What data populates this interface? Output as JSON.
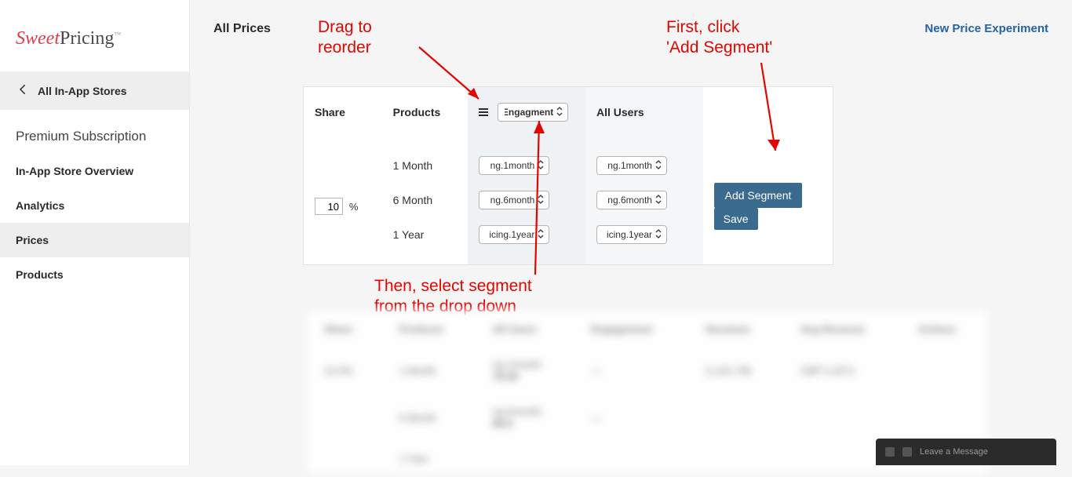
{
  "logo": {
    "part1": "Sweet",
    "part2": "Pricing",
    "tm": "™"
  },
  "sidebar": {
    "back_label": "All In-App Stores",
    "section_title": "Premium Subscription",
    "items": [
      {
        "label": "In-App Store Overview"
      },
      {
        "label": "Analytics"
      },
      {
        "label": "Prices"
      },
      {
        "label": "Products"
      }
    ]
  },
  "page": {
    "title": "All Prices",
    "new_experiment": "New Price Experiment"
  },
  "table": {
    "headers": {
      "share": "Share",
      "products": "Products",
      "segment_select": "Engagment",
      "all_users": "All Users"
    },
    "share_value": "10",
    "share_suffix": "%",
    "rows": [
      {
        "product": "1 Month",
        "seg_value": "ng.1month",
        "users_value": "ng.1month"
      },
      {
        "product": "6 Month",
        "seg_value": "ng.6month",
        "users_value": "ng.6month"
      },
      {
        "product": "1 Year",
        "seg_value": "icing.1year",
        "users_value": "icing.1year"
      }
    ],
    "actions": {
      "add_segment": "Add Segment",
      "save": "Save"
    }
  },
  "annotations": {
    "drag": "Drag to\nreorder",
    "first_click": "First, click\n'Add Segment'",
    "then_select": "Then, select segment\nfrom the drop down"
  },
  "blur_headers": [
    "Share",
    "Products",
    "All Users",
    "Engagement",
    "Sessions",
    "Avg Revenue",
    "Actions"
  ],
  "chat": {
    "label": "Leave a Message"
  }
}
